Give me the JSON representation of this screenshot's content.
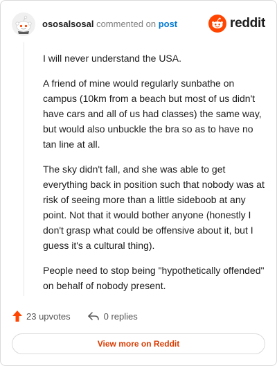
{
  "header": {
    "username": "ososalsosal",
    "action_text": "commented on",
    "post_link": "post",
    "brand_text": "reddit"
  },
  "comment": {
    "paragraphs": [
      "I will never understand the USA.",
      "A friend of mine would regularly sunbathe on campus (10km from a beach but most of us didn't have cars and all of us had classes) the same way, but would also unbuckle the bra so as to have no tan line at all.",
      "The sky didn't fall, and she was able to get everything back in position such that nobody was at risk of seeing more than a little sideboob at any point. Not that it would bother anyone (honestly I don't grasp what could be offensive about it, but I guess it's a cultural thing).",
      "People need to stop being \"hypothetically offended\" on behalf of nobody present."
    ]
  },
  "footer": {
    "upvotes": "23 upvotes",
    "replies": "0 replies"
  },
  "view_more_label": "View more on Reddit",
  "colors": {
    "accent": "#ff4500",
    "link": "#0079d3",
    "view_more": "#d93a00"
  },
  "icons": [
    "snoo-avatar-icon",
    "reddit-logo-icon",
    "upvote-arrow-icon",
    "reply-icon"
  ]
}
